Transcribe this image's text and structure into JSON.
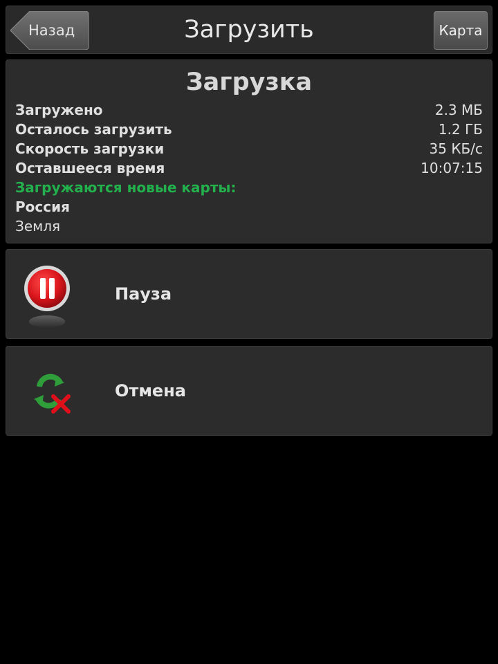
{
  "header": {
    "back_label": "Назад",
    "title": "Загрузить",
    "map_label": "Карта"
  },
  "download": {
    "title": "Загрузка",
    "stats": [
      {
        "label": "Загружено",
        "value": "2.3 МБ"
      },
      {
        "label": "Осталось загрузить",
        "value": "1.2 ГБ"
      },
      {
        "label": "Скорость загрузки",
        "value": "35 КБ/с"
      },
      {
        "label": "Оставшееся время",
        "value": "10:07:15"
      }
    ],
    "new_maps_label": "Загружаются новые карты:",
    "maps": [
      "Россия",
      "Земля"
    ]
  },
  "actions": {
    "pause_label": "Пауза",
    "cancel_label": "Отмена"
  },
  "icons": {
    "back": "back-arrow-icon",
    "pause": "pause-icon",
    "cancel": "cancel-refresh-icon"
  },
  "colors": {
    "accent_green": "#22b14c",
    "pause_red": "#d9161c",
    "cancel_x": "#e0101a"
  }
}
